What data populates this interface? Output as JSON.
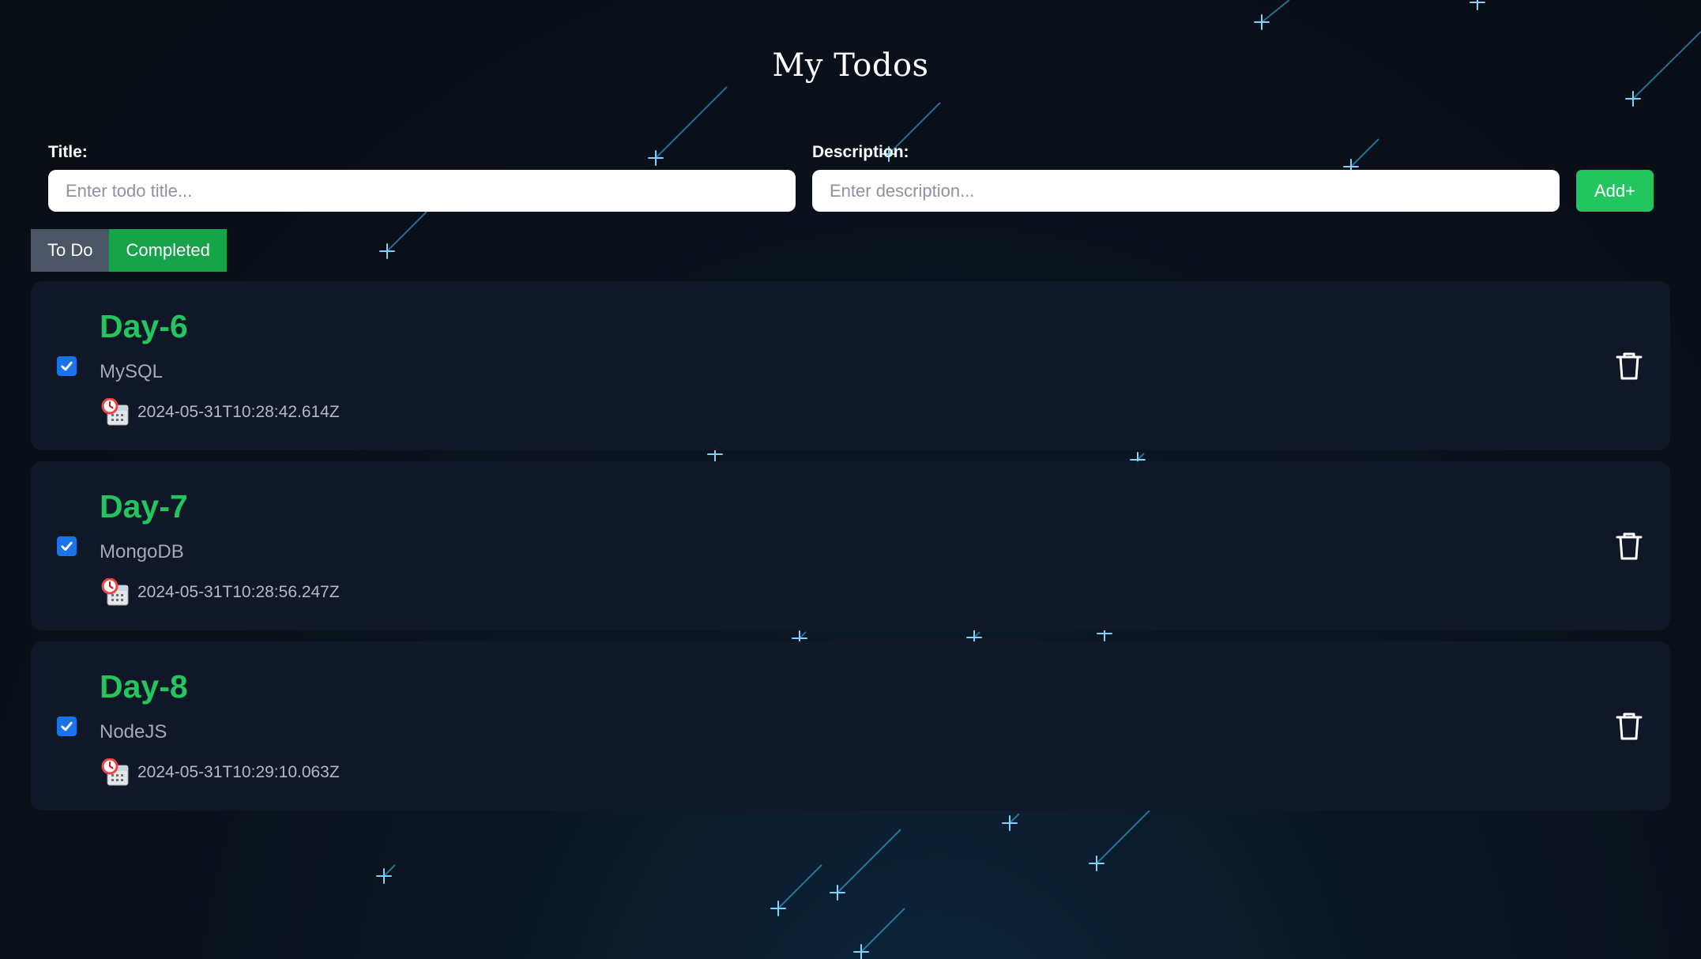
{
  "header": {
    "title": "My Todos"
  },
  "form": {
    "title_label": "Title:",
    "title_placeholder": "Enter todo title...",
    "title_value": "",
    "description_label": "Description:",
    "description_placeholder": "Enter description...",
    "description_value": "",
    "add_label": "Add+"
  },
  "tabs": [
    {
      "label": "To Do",
      "active": false
    },
    {
      "label": "Completed",
      "active": true
    }
  ],
  "todos": [
    {
      "title": "Day-6",
      "description": "MySQL",
      "timestamp": "2024-05-31T10:28:42.614Z",
      "completed": true
    },
    {
      "title": "Day-7",
      "description": "MongoDB",
      "timestamp": "2024-05-31T10:28:56.247Z",
      "completed": true
    },
    {
      "title": "Day-8",
      "description": "NodeJS",
      "timestamp": "2024-05-31T10:29:10.063Z",
      "completed": true
    }
  ],
  "icons": {
    "checkbox": "checkbox-checked-icon",
    "timestamp": "calendar-clock-icon",
    "delete": "trash-icon"
  },
  "colors": {
    "accent_green": "#22c55e",
    "tab_completed": "#16a34a",
    "tab_todo": "#4b5563",
    "checkbox_blue": "#1a73e8",
    "card_bg": "#111827"
  }
}
